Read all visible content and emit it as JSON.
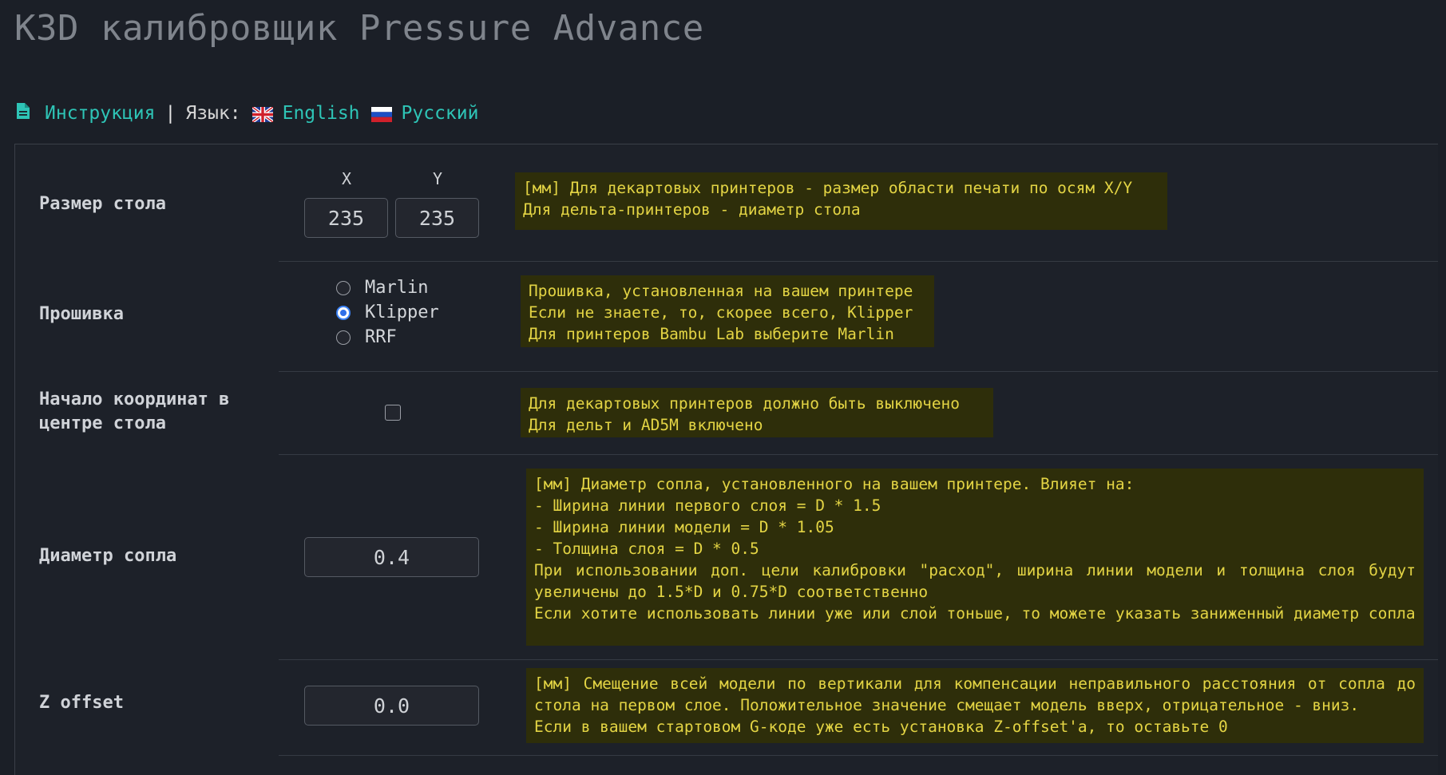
{
  "title": "K3D калибровщик Pressure Advance",
  "nav": {
    "instructions": "Инструкция",
    "separator": "|",
    "language_label": "Язык:",
    "english": "English",
    "russian": "Русский",
    "link_color": "#2ec4b6"
  },
  "rows": {
    "bed_size": {
      "label": "Размер стола",
      "x_label": "X",
      "y_label": "Y",
      "x_value": "235",
      "y_value": "235",
      "hint": "[мм] Для декартовых принтеров - размер области печати по осям X/Y\nДля дельта-принтеров - диаметр стола"
    },
    "firmware": {
      "label": "Прошивка",
      "options": [
        "Marlin",
        "Klipper",
        "RRF"
      ],
      "selected": "Klipper",
      "hint": "Прошивка, установленная на вашем принтере\nЕсли не знаете, то, скорее всего, Klipper\nДля принтеров Bambu Lab выберите Marlin"
    },
    "origin_center": {
      "label": "Начало координат в центре стола",
      "checked": false,
      "hint": "Для декартовых принтеров должно быть выключено\nДля дельт и AD5M включено"
    },
    "nozzle": {
      "label": "Диаметр сопла",
      "value": "0.4",
      "hint": "[мм] Диаметр сопла, установленного на вашем принтере. Влияет на:\n- Ширина линии первого слоя = D * 1.5\n- Ширина линии модели = D * 1.05\n- Толщина слоя = D * 0.5\nПри использовании доп. цели калибровки \"расход\", ширина линии модели и толщина слоя будут увеличены до 1.5*D и 0.75*D соответственно\nЕсли хотите использовать линии уже или слой тоньше, то можете указать заниженный диаметр сопла"
    },
    "z_offset": {
      "label": "Z offset",
      "value": "0.0",
      "hint": "[мм] Смещение всей модели по вертикали для компенсации неправильного расстояния от сопла до стола на первом слое. Положительное значение смещает модель вверх, отрицательное - вниз.\nЕсли в вашем стартовом G-коде уже есть установка Z-offset'a, то оставьте 0"
    }
  }
}
